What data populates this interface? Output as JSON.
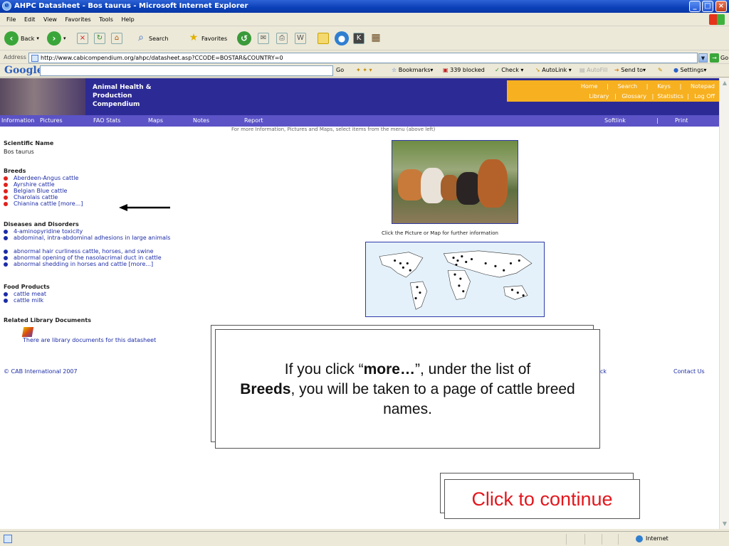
{
  "window": {
    "title": "AHPC Datasheet - Bos taurus - Microsoft Internet Explorer"
  },
  "menu": [
    "File",
    "Edit",
    "View",
    "Favorites",
    "Tools",
    "Help"
  ],
  "toolbar": {
    "back": "Back",
    "search": "Search",
    "favorites": "Favorites"
  },
  "address": {
    "label": "Address",
    "url": "http://www.cabicompendium.org/ahpc/datasheet.asp?CCODE=BOSTAR&COUNTRY=0",
    "go": "Go"
  },
  "googlebar": {
    "logo": "Google",
    "go": "Go",
    "bookmarks": "Bookmarks",
    "blocked": "339 blocked",
    "check": "Check",
    "autolink": "AutoLink",
    "autofill": "AutoFill",
    "sendto": "Send to",
    "settings": "Settings"
  },
  "site": {
    "title_lines": [
      "Animal Health &",
      "Production",
      "Compendium"
    ],
    "topnav_row1": [
      "Home",
      "Search",
      "Keys",
      "Notepad"
    ],
    "topnav_row2": [
      "Library",
      "Glossary",
      "Statistics",
      "Log Off"
    ],
    "nav": [
      "Information",
      "Pictures",
      "FAO Stats",
      "Maps",
      "Notes",
      "Report",
      "Softlink",
      "Print"
    ],
    "hint": "For more Information, Pictures and Maps, select items from the menu (above left)"
  },
  "datasheet": {
    "sci_heading": "Scientific Name",
    "sci_name": "Bos taurus",
    "breeds_heading": "Breeds",
    "breeds": [
      "Aberdeen-Angus cattle",
      "Ayrshire cattle",
      "Belgian Blue cattle",
      "Charolais cattle",
      "Chianina cattle  [more...]"
    ],
    "diseases_heading": "Diseases and Disorders",
    "diseases": [
      "4-aminopyridine toxicity",
      "abdominal, intra-abdominal adhesions in large animals",
      "abnormal hair curliness cattle, horses, and swine",
      "abnormal opening of the nasolacrimal duct in cattle",
      "abnormal shedding in horses and cattle  [more...]"
    ],
    "food_heading": "Food Products",
    "food": [
      "cattle meat",
      "cattle milk"
    ],
    "library_heading": "Related Library Documents",
    "library_text": "There are library documents for this datasheet",
    "picture_caption": "Click the Picture or Map for further information",
    "copyright": "© CAB International 2007",
    "footer_partial": "ck",
    "contact": "Contact Us"
  },
  "callout": {
    "pre": "If you click “",
    "bold1": "more…",
    "mid": "”, under the list of",
    "bold2": "Breeds",
    "post": ", you will be taken to a page of cattle breed names."
  },
  "continue_label": "Click to continue",
  "status": {
    "zone": "Internet"
  },
  "colors": {
    "accent_red": "#e3171d",
    "banner": "#2c2a94",
    "nav": "#5b53c6",
    "topnav": "#f7b01f",
    "link": "#1c2ca6"
  }
}
